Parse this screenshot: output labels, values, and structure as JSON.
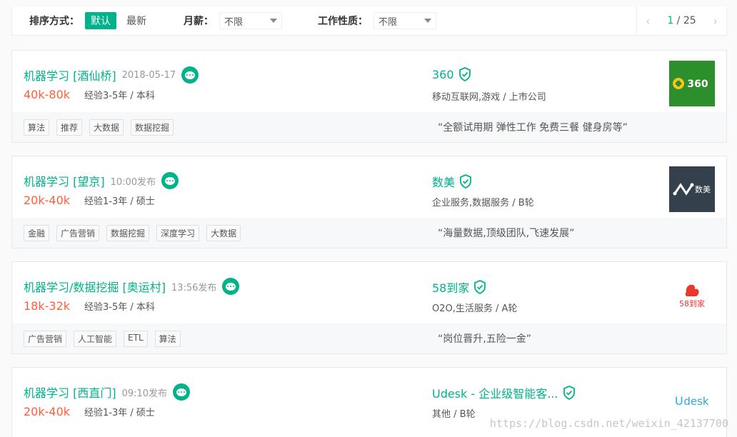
{
  "filters": {
    "sort_label": "排序方式：",
    "sort_options": [
      "默认",
      "最新"
    ],
    "salary_label": "月薪：",
    "salary_value": "不限",
    "jobtype_label": "工作性质：",
    "jobtype_value": "不限",
    "pager": {
      "current": "1",
      "sep": " / ",
      "total": "25"
    }
  },
  "colors": {
    "accent": "#00b38a",
    "salary": "#fd5f39"
  },
  "jobs": [
    {
      "title": "机器学习 [酒仙桥]",
      "time": "2018-05-17",
      "salary": "40k-80k",
      "requirement": "经验3-5年 / 本科",
      "company": "360",
      "industry": "移动互联网,游戏 / 上市公司",
      "tags": [
        "算法",
        "推荐",
        "大数据",
        "数据挖掘"
      ],
      "slogan": "“全额试用期 弹性工作 免费三餐 健身房等”",
      "logo_text": "360"
    },
    {
      "title": "机器学习 [望京]",
      "time": "10:00发布",
      "salary": "20k-40k",
      "requirement": "经验1-3年 / 硕士",
      "company": "数美",
      "industry": "企业服务,数据服务 / B轮",
      "tags": [
        "金融",
        "广告营销",
        "数据挖掘",
        "深度学习",
        "大数据"
      ],
      "slogan": "“海量数据,顶级团队,飞速发展”",
      "logo_text": "数美"
    },
    {
      "title": "机器学习/数据挖掘 [奥运村]",
      "time": "13:56发布",
      "salary": "18k-32k",
      "requirement": "经验3-5年 / 本科",
      "company": "58到家",
      "industry": "O2O,生活服务 / A轮",
      "tags": [
        "广告营销",
        "人工智能",
        "ETL",
        "算法"
      ],
      "slogan": "“岗位晋升,五险一金”",
      "logo_text": "58到家"
    },
    {
      "title": "机器学习 [西直门]",
      "time": "09:10发布",
      "salary": "20k-40k",
      "requirement": "经验1-3年 / 硕士",
      "company": "Udesk - 企业级智能客...",
      "industry": "其他 / B轮",
      "tags": [],
      "slogan": "",
      "logo_text": "desk"
    }
  ],
  "watermark": "https://blog.csdn.net/weixin_42137700"
}
